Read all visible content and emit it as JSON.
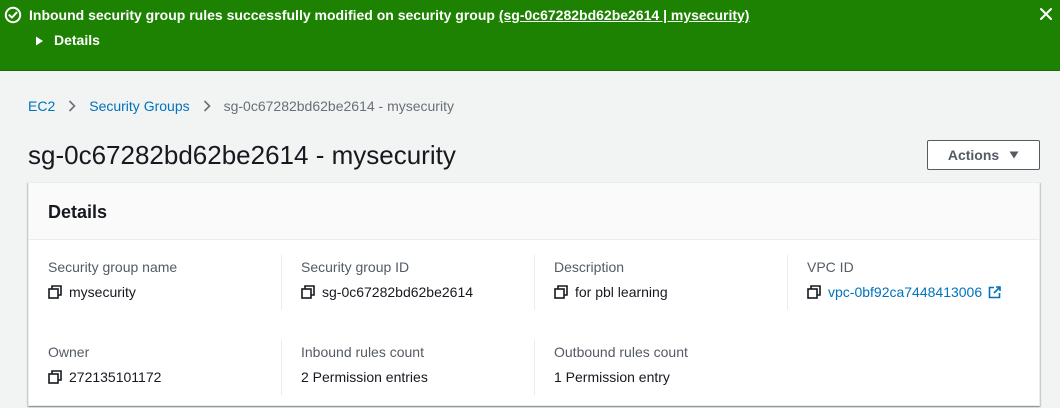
{
  "flash": {
    "message_prefix": "Inbound security group rules successfully modified on security group",
    "message_link": "(sg-0c67282bd62be2614 | mysecurity)",
    "details_label": "Details",
    "color": "#1d8102",
    "icons": [
      "success-icon",
      "caret-right-icon",
      "close-icon"
    ]
  },
  "breadcrumb": {
    "items": [
      "EC2",
      "Security Groups",
      "sg-0c67282bd62be2614 - mysecurity"
    ]
  },
  "page": {
    "title": "sg-0c67282bd62be2614 - mysecurity",
    "actions_label": "Actions"
  },
  "details": {
    "heading": "Details",
    "fields": [
      {
        "label": "Security group name",
        "value": "mysecurity"
      },
      {
        "label": "Security group ID",
        "value": "sg-0c67282bd62be2614"
      },
      {
        "label": "Description",
        "value": "for pbl learning"
      },
      {
        "label": "VPC ID",
        "value": "vpc-0bf92ca7448413006"
      },
      {
        "label": "Owner",
        "value": "272135101172"
      },
      {
        "label": "Inbound rules count",
        "value": "2 Permission entries"
      },
      {
        "label": "Outbound rules count",
        "value": "1 Permission entry"
      }
    ]
  },
  "colors": {
    "link": "#0073bb",
    "success": "#1d8102",
    "background": "#f2f3f3"
  }
}
